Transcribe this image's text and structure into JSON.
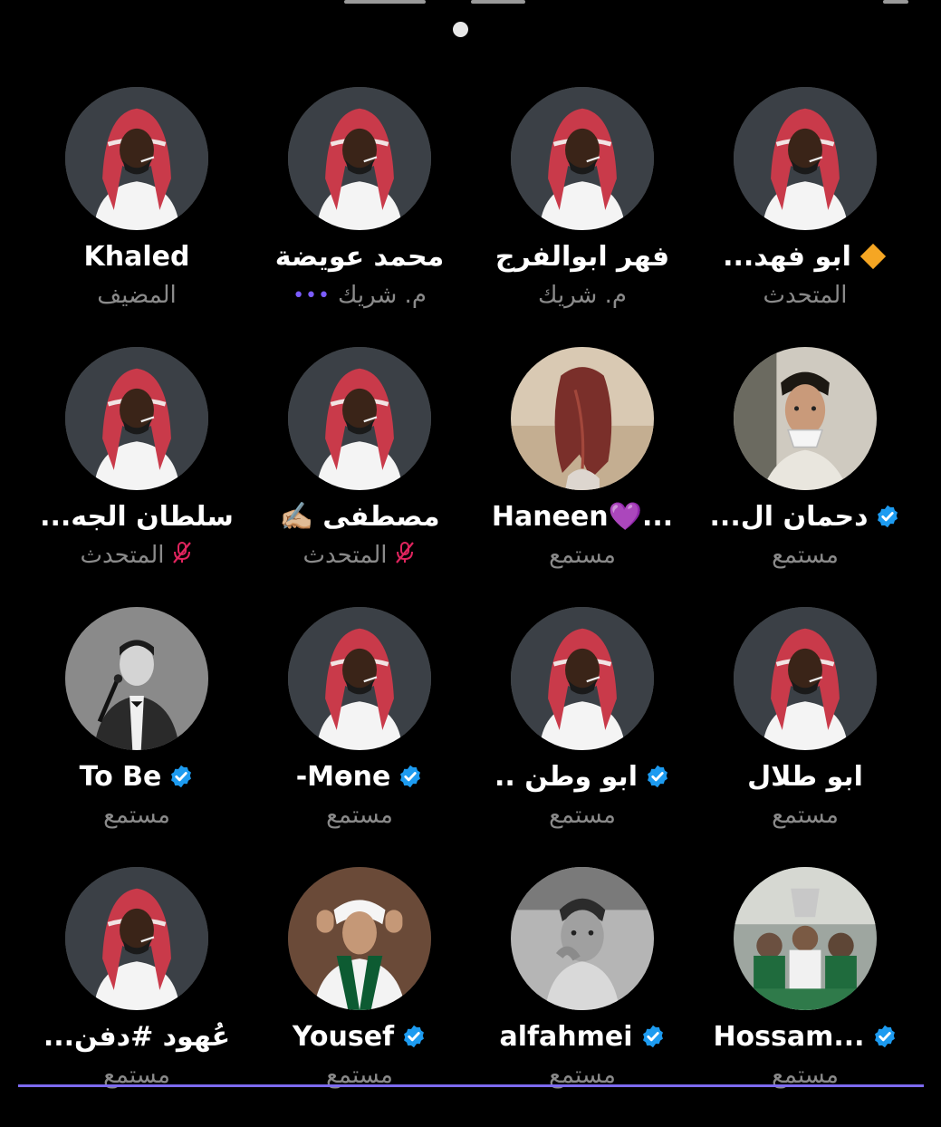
{
  "colors": {
    "background": "#000000",
    "name_text": "#ffffff",
    "role_text": "#8a8a8a",
    "verified_badge": "#1d9bf0",
    "diamond": "#f5a623",
    "mic_off": "#e0245e",
    "heart": "#8b3cf7",
    "dots": "#7b5cff"
  },
  "participants": [
    {
      "name": "ابو فهد...",
      "role": "المتحدث",
      "badge": "diamond-icon",
      "avatar": "man-ghutra"
    },
    {
      "name": "فهر ابوالفرج",
      "role": "م. شريك",
      "badge": "",
      "avatar": "man-ghutra"
    },
    {
      "name": "محمد عويضة",
      "role": "م. شريك",
      "badge": "",
      "role_icon": "more-dots-icon",
      "avatar": "man-ghutra"
    },
    {
      "name": "Khaled",
      "role": "المضيف",
      "badge": "",
      "avatar": "man-ghutra"
    },
    {
      "name": "دحمان ال...",
      "role": "مستمع",
      "badge": "verified-icon",
      "avatar": "man-teacup"
    },
    {
      "name": "Haneen💜...",
      "role": "مستمع",
      "badge": "",
      "avatar": "woman-hair"
    },
    {
      "name": "مصطفى ✍🏼",
      "role": "المتحدث",
      "badge": "",
      "role_icon": "mic-off-icon",
      "avatar": "man-ghutra"
    },
    {
      "name": "سلطان الجه...",
      "role": "المتحدث",
      "badge": "",
      "role_icon": "mic-off-icon",
      "avatar": "man-ghutra"
    },
    {
      "name": "ابو طلال",
      "role": "مستمع",
      "badge": "",
      "avatar": "man-ghutra"
    },
    {
      "name": "ابو وطن ..",
      "role": "مستمع",
      "badge": "verified-icon",
      "avatar": "man-ghutra"
    },
    {
      "name": "-Mөne",
      "role": "مستمع",
      "badge": "verified-icon",
      "avatar": "man-ghutra"
    },
    {
      "name": "To Be",
      "role": "مستمع",
      "badge": "verified-icon",
      "avatar": "singer-mic"
    },
    {
      "name": "Hossam...",
      "role": "مستمع",
      "badge": "verified-icon",
      "avatar": "team-crowd"
    },
    {
      "name": "alfahmei",
      "role": "مستمع",
      "badge": "verified-icon",
      "avatar": "child-bw"
    },
    {
      "name": "Yousef",
      "role": "مستمع",
      "badge": "verified-icon",
      "avatar": "man-scarf"
    },
    {
      "name": "عُهود #دفن...",
      "role": "مستمع",
      "badge": "",
      "avatar": "man-ghutra"
    }
  ]
}
